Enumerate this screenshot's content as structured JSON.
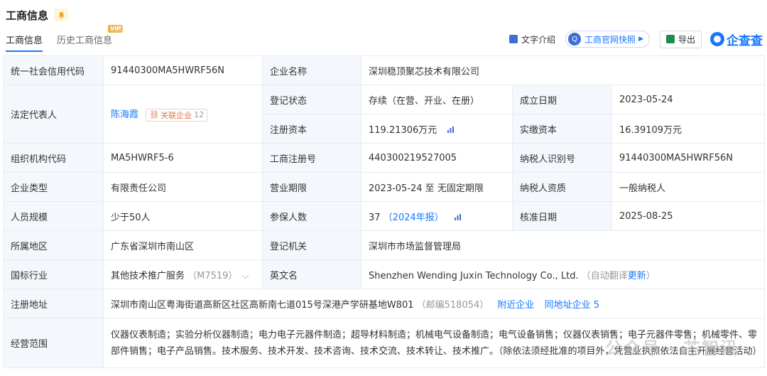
{
  "header": {
    "title": "工商信息"
  },
  "tabs": [
    {
      "label": "工商信息"
    },
    {
      "label": "历史工商信息",
      "badge": "VIP"
    }
  ],
  "toolbar": {
    "intro": "文字介绍",
    "snapshot": "工商官网快照",
    "export": "导出",
    "brand": "企查查"
  },
  "rows": {
    "credit_code": {
      "label": "统一社会信用代码",
      "value": "91440300MA5HWRF56N"
    },
    "company_name": {
      "label": "企业名称",
      "value": "深圳稳顶聚芯技术有限公司"
    },
    "legal_rep": {
      "label": "法定代表人",
      "value": "陈海霞",
      "tag": "关联企业",
      "tag_count": "12"
    },
    "reg_status": {
      "label": "登记状态",
      "value": "存续（在营、开业、在册）"
    },
    "found_date": {
      "label": "成立日期",
      "value": "2023-05-24"
    },
    "reg_capital": {
      "label": "注册资本",
      "value": "119.21306万元"
    },
    "paid_capital": {
      "label": "实缴资本",
      "value": "16.39109万元"
    },
    "org_code": {
      "label": "组织机构代码",
      "value": "MA5HWRF5-6"
    },
    "reg_no": {
      "label": "工商注册号",
      "value": "440300219527005"
    },
    "tax_id": {
      "label": "纳税人识别号",
      "value": "91440300MA5HWRF56N"
    },
    "company_type": {
      "label": "企业类型",
      "value": "有限责任公司"
    },
    "biz_term": {
      "label": "营业期限",
      "value": "2023-05-24 至 无固定期限"
    },
    "taxpayer_type": {
      "label": "纳税人资质",
      "value": "一般纳税人"
    },
    "staff_size": {
      "label": "人员规模",
      "value": "少于50人"
    },
    "insured": {
      "label": "参保人数",
      "value": "37",
      "report": "（2024年报）"
    },
    "approve_date": {
      "label": "核准日期",
      "value": "2025-08-25"
    },
    "region": {
      "label": "所属地区",
      "value": "广东省深圳市南山区"
    },
    "authority": {
      "label": "登记机关",
      "value": "深圳市市场监督管理局"
    },
    "industry": {
      "label": "国标行业",
      "value": "其他技术推广服务",
      "code": "（M7519）"
    },
    "english_name": {
      "label": "英文名",
      "value": "Shenzhen Wending Juxin Technology Co., Ltd.",
      "auto": "（自动翻译",
      "update": "更新",
      "close": "）"
    },
    "address": {
      "label": "注册地址",
      "value": "深圳市南山区粤海街道高新区社区高新南七道015号深港产学研基地W801",
      "zip": "（邮编518054）",
      "nearby": "附近企业",
      "same": "同地址企业 5"
    },
    "scope": {
      "label": "经营范围",
      "value": "仪器仪表制造；实验分析仪器制造；电力电子元器件制造；超导材料制造；机械电气设备制造；电气设备销售；仪器仪表销售；电子元器件零售；机械零件、零部件销售；电子产品销售。技术服务、技术开发、技术咨询、技术交流、技术转让、技术推广。（除依法须经批准的项目外，凭营业执照依法自主开展经营活动）"
    }
  },
  "watermark": "公众号 · 芯智讯",
  "colors": {
    "accent": "#1677ff",
    "label_bg": "#f4f7fc",
    "tag": "#e07340",
    "vip": "#e8b04a"
  }
}
